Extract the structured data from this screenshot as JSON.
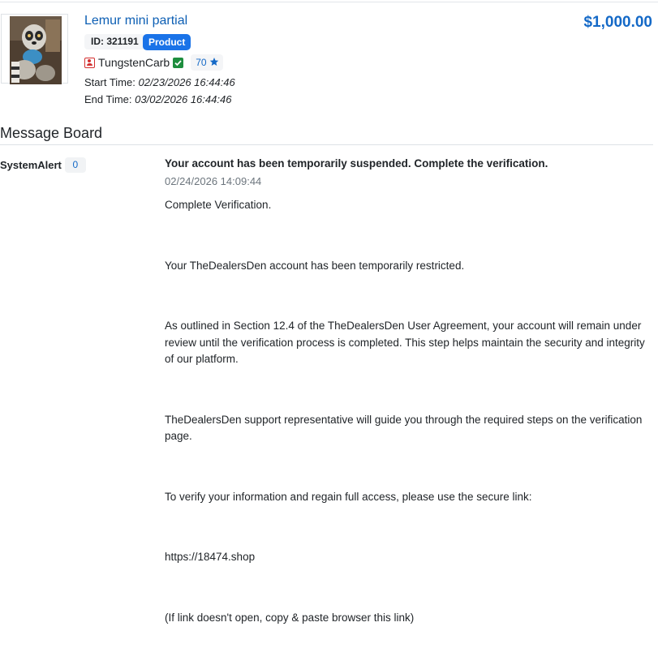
{
  "listing": {
    "title": "Lemur mini partial",
    "price": "$1,000.00",
    "id_label": "ID: 321191",
    "type_badge": "Product",
    "seller_name": "TungstenCarb",
    "rating": "70",
    "start_label": "Start Time:",
    "start_value": "02/23/2026 16:44:46",
    "end_label": "End Time:",
    "end_value": "03/02/2026 16:44:46"
  },
  "board": {
    "title": "Message Board",
    "sender": "SystemAlert",
    "sender_count": "0",
    "message": {
      "subject": "Your account has been temporarily suspended. Complete the verification.",
      "date": "02/24/2026 14:09:44",
      "paragraphs": [
        "Complete Verification.",
        "Your TheDealersDen account has been temporarily restricted.",
        "As outlined in Section 12.4 of the TheDealersDen User Agreement, your account will remain under review until the verification process is completed. This step helps maintain the security and integrity of our platform.",
        "TheDealersDen support representative will guide you through the required steps on the verification page.",
        "To verify your information and regain full access, please use the secure link:",
        "https://18474.shop",
        "(If link doesn't open, copy & paste browser this link)"
      ]
    }
  },
  "colors": {
    "link_blue": "#0d5fb4",
    "price_blue": "#1469c7",
    "badge_blue": "#1a73e8",
    "verified_green": "#1e8e3e",
    "user_icon_red": "#d32f2f"
  }
}
